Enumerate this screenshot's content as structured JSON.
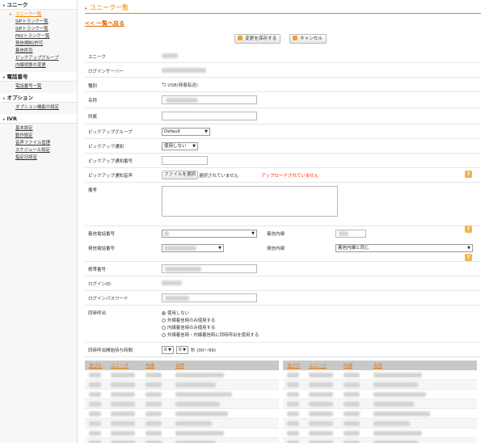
{
  "sidebar": {
    "sections": [
      {
        "title": "ユニーク",
        "items": [
          {
            "label": "ユニーク一覧",
            "active": true
          },
          {
            "label": "SIPトランク一覧"
          },
          {
            "label": "SIPトランク一覧"
          },
          {
            "label": "FAXトランク一覧"
          },
          {
            "label": "発信規制/許可"
          },
          {
            "label": "着信拒否"
          },
          {
            "label": "ピックアップグループ"
          },
          {
            "label": "内線状態の変更"
          }
        ]
      },
      {
        "title": "電話番号",
        "items": [
          {
            "label": "電話番号一覧"
          }
        ]
      },
      {
        "title": "オプション",
        "items": [
          {
            "label": "オプション機能の設定"
          }
        ]
      },
      {
        "title": "IVR",
        "items": [
          {
            "label": "基本設定"
          },
          {
            "label": "動作設定"
          },
          {
            "label": "音声ファイル管理"
          },
          {
            "label": "スケジュール設定"
          },
          {
            "label": "指定日設定"
          }
        ]
      }
    ]
  },
  "main": {
    "title": "ユニーク一覧",
    "back_link": "<< 一覧へ戻る",
    "save_button": "変更を保存する",
    "cancel_button": "キャンセル"
  },
  "form": {
    "unique_label": "ユニーク",
    "login_server_label": "ログインサーバー",
    "type_label": "種別",
    "type_value": "USB(発着転送)",
    "name_label": "名称",
    "affiliation_label": "所属",
    "pickup_group_label": "ピックアップグループ",
    "pickup_group_value": "Default",
    "pickup_notify_label": "ピックアップ通知",
    "pickup_notify_value": "使用しない",
    "pickup_notify_number_label": "ピックアップ通知番号",
    "pickup_notify_sound_label": "ピックアップ通知音声",
    "file_button": "ファイルを選択",
    "no_file_text": "選択されていません",
    "not_uploaded_text": "アップロードされていません",
    "notes_label": "備考",
    "incoming_number_label": "着信電話番号",
    "incoming_ext_label": "着信内線",
    "outgoing_number_label": "発信電話番号",
    "outgoing_ext_label": "発信内線",
    "outgoing_ext_value": "着信内線と同じ",
    "mobile_label": "携帯番号",
    "login_id_label": "ログインID",
    "login_password_label": "ログインパスワード",
    "simul_call_label": "同時呼出",
    "simul_options": [
      "使用しない",
      "外線着信時のみ使用する",
      "内線着信時のみ使用する",
      "外線着信時・内線着信時に同時呼出を使用する"
    ],
    "simul_wait_label": "同時呼出開始待ち時間",
    "simul_wait_value1": "0",
    "simul_wait_value2": "0",
    "simul_wait_suffix": "秒 (00〜99)"
  },
  "table": {
    "headers": [
      "並びた",
      "ユニーク",
      "内線",
      "名称"
    ]
  },
  "icons": {
    "help": "question-icon",
    "back": "undo-icon"
  },
  "colors": {
    "accent": "#f08300",
    "error": "#ff2200"
  }
}
